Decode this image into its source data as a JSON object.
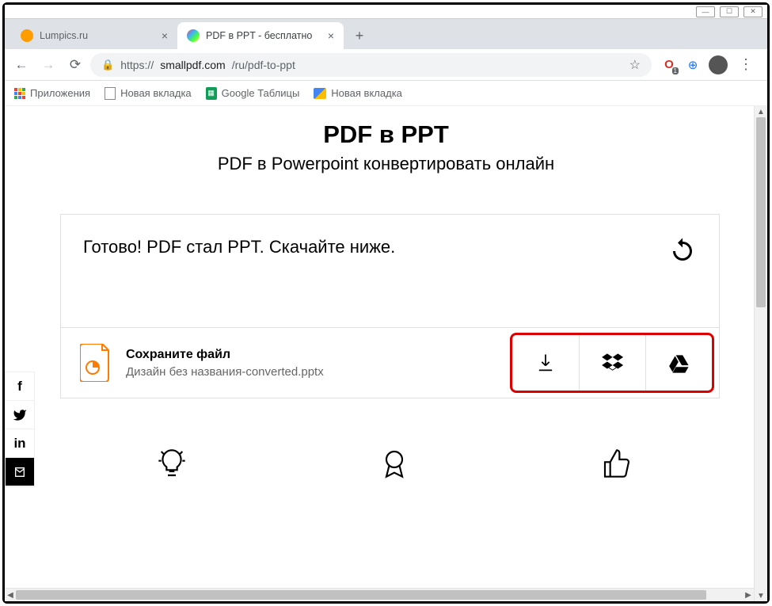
{
  "window_controls": {
    "min": "—",
    "max": "☐",
    "close": "✕"
  },
  "tabs": [
    {
      "title": "Lumpics.ru",
      "icon_color": "#ff9c00",
      "active": false
    },
    {
      "title": "PDF в PPT - бесплатно",
      "icon_color": "#linear",
      "active": true
    }
  ],
  "address": {
    "scheme": "https://",
    "host": "smallpdf.com",
    "path": "/ru/pdf-to-ppt"
  },
  "bookmarks": {
    "apps": "Приложения",
    "item1": "Новая вкладка",
    "item2": "Google Таблицы",
    "item3": "Новая вкладка"
  },
  "page": {
    "title": "PDF в PPT",
    "subtitle": "PDF в Powerpoint конвертировать онлайн",
    "status": "Готово! PDF стал PPT. Скачайте ниже.",
    "save_title": "Сохраните файл",
    "filename": "Дизайн без названия-converted.pptx"
  }
}
